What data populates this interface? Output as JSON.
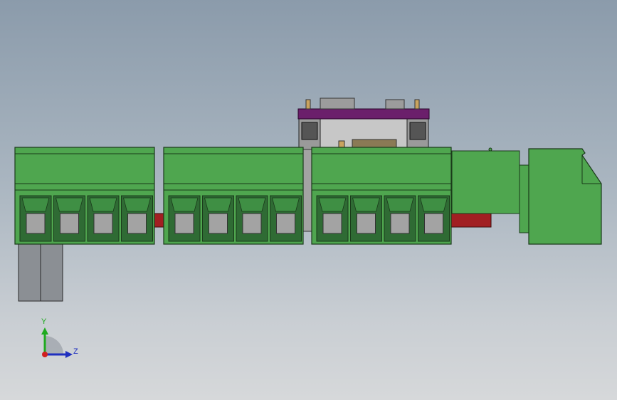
{
  "viewport": {
    "background_top": "#8b9bab",
    "background_bottom": "#d6d8da"
  },
  "model": {
    "terminal_green": "#4fa64f",
    "terminal_dark": "#2f6b34",
    "terminal_edge": "#1a3a1a",
    "clamp_gray": "#a3a3a3",
    "busbar_red": "#a11f22",
    "pcb_purple": "#6b1f6b",
    "bracket_gray": "#9a9a9a",
    "cable_gray": "#8b8f94",
    "blocks_count": 3,
    "positions_per_block": 4
  },
  "triad": {
    "y_label": "Y",
    "z_label": "Z",
    "y_color": "#1faa1f",
    "z_color": "#1f2fbf",
    "origin_color": "#d11f1f"
  }
}
